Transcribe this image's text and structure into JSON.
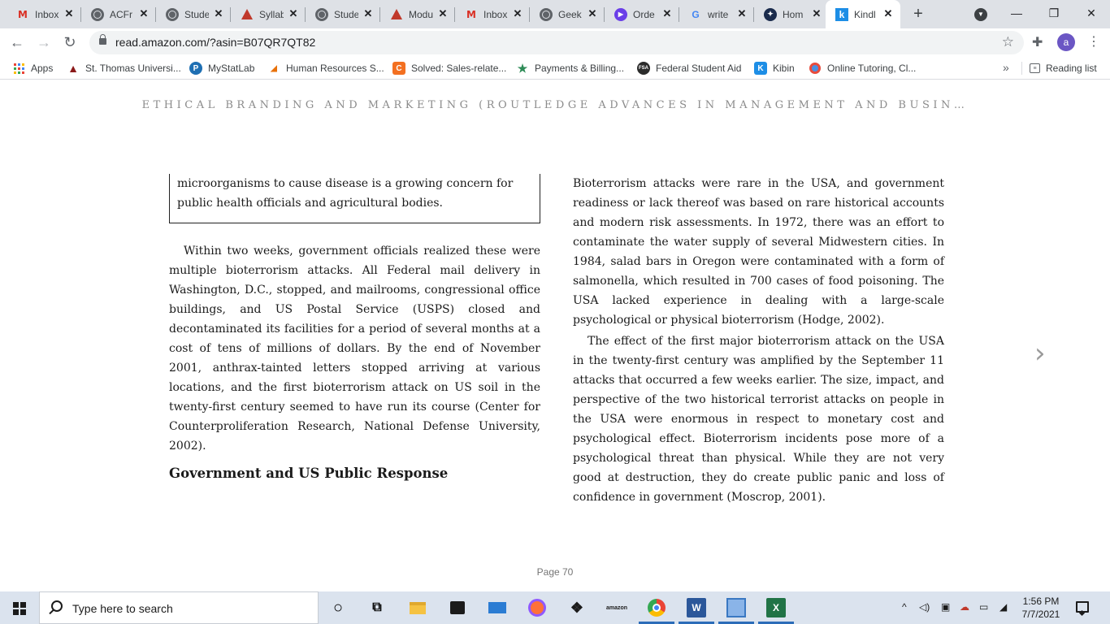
{
  "browser": {
    "tabs": [
      {
        "title": "Inbox",
        "icon": "gmail-icon"
      },
      {
        "title": "ACFr",
        "icon": "globe-icon"
      },
      {
        "title": "Stude",
        "icon": "globe-icon"
      },
      {
        "title": "Syllab",
        "icon": "canvas-icon"
      },
      {
        "title": "Stude",
        "icon": "globe-icon"
      },
      {
        "title": "Modu",
        "icon": "canvas-icon"
      },
      {
        "title": "Inbox",
        "icon": "gmail-icon"
      },
      {
        "title": "Geek",
        "icon": "globe-icon"
      },
      {
        "title": "Orde",
        "icon": "play-icon"
      },
      {
        "title": "write",
        "icon": "google-icon"
      },
      {
        "title": "Hom",
        "icon": "home-icon"
      },
      {
        "title": "Kindl",
        "icon": "kindle-icon"
      }
    ],
    "url": "read.amazon.com/?asin=B07QR7QT82",
    "avatar_letter": "a",
    "bookmarks": [
      {
        "label": "Apps"
      },
      {
        "label": "St. Thomas Universi..."
      },
      {
        "label": "MyStatLab"
      },
      {
        "label": "Human Resources S..."
      },
      {
        "label": "Solved: Sales-relate..."
      },
      {
        "label": "Payments & Billing..."
      },
      {
        "label": "Federal Student Aid"
      },
      {
        "label": "Kibin"
      },
      {
        "label": "Online Tutoring, Cl..."
      }
    ],
    "bookmarks_overflow": "»",
    "reading_list": "Reading list"
  },
  "reader": {
    "book_title": "ETHICAL BRANDING AND MARKETING (ROUTLEDGE ADVANCES IN MANAGEMENT AND BUSIN…",
    "boxed_text": "microorganisms to cause disease is a growing concern for public health officials and agricultural bodies.",
    "left_paragraph": "Within two weeks, government officials realized these were multiple bioterrorism attacks. All Federal mail delivery in Washington, D.C., stopped, and mailrooms, congressional office buildings, and US Postal Service (USPS) closed and decontaminated its facilities for a period of several months at a cost of tens of millions of dollars. By the end of November 2001, anthrax-tainted letters stopped arriving at various locations, and the first bioterrorism attack on US soil in the twenty-first century seemed to have run its course (Center for Counterproliferation Research, National Defense University, 2002).",
    "section_heading": "Government and US Public Response",
    "right_paragraph_1": "Bioterrorism attacks were rare in the USA, and government readiness or lack thereof was based on rare historical accounts and modern risk assessments. In 1972, there was an effort to contaminate the water supply of several Midwestern cities. In 1984, salad bars in Oregon were contaminated with a form of salmonella, which resulted in 700 cases of food poisoning. The USA lacked experience in dealing with a large-scale psychological or physical bioterrorism (Hodge, 2002).",
    "right_paragraph_2": "The effect of the first major bioterrorism attack on the USA in the twenty-first century was amplified by the September 11 attacks that occurred a few weeks earlier. The size, impact, and perspective of the two historical terrorist attacks on people in the USA were enormous in respect to monetary cost and psychological effect. Bioterrorism incidents pose more of a psychological threat than physical. While they are not very good at destruction, they do create public panic and loss of confidence in government (Moscrop, 2001).",
    "page_label": "Page 70"
  },
  "taskbar": {
    "search_placeholder": "Type here to search",
    "time": "1:56 PM",
    "date": "7/7/2021"
  },
  "colors": {
    "tabstrip_bg": "#dee1e6",
    "kindle_blue": "#1d8ee6",
    "taskbar_bg": "#dbe3ee"
  }
}
